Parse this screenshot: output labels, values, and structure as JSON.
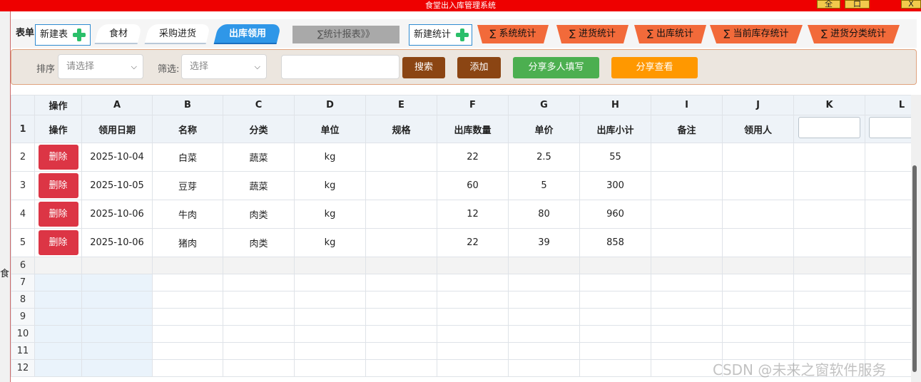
{
  "window": {
    "title": "食堂出入库管理系统",
    "buttons": {
      "fullscreen": "全",
      "restore": "口",
      "close": "X"
    }
  },
  "left_edge": {
    "stub_a": "食"
  },
  "tabs": {
    "form_label": "表单",
    "new_table": "新建表",
    "items": [
      "食材",
      "采购进货",
      "出库领用"
    ],
    "active": "出库领用",
    "report": "∑统计报表》》",
    "new_stat": "新建统计",
    "stats": [
      "∑ 系统统计",
      "∑ 进货统计",
      "∑ 出库统计",
      "∑ 当前库存统计",
      "∑ 进货分类统计"
    ]
  },
  "filter": {
    "sort_label": "排序",
    "sort_placeholder": "请选择",
    "filter_label": "筛选:",
    "filter_placeholder": "选择",
    "search_value": "",
    "search_btn": "搜索",
    "add_btn": "添加",
    "share_fill_btn": "分享多人填写",
    "share_view_btn": "分享查看"
  },
  "colors": {
    "titlebar": "#ee0000",
    "active_tab": "#2f97e8",
    "stat_tab": "#f26a3a",
    "search_btn": "#8b4513",
    "add_btn": "#8b4513",
    "share_fill_btn": "#4caf50",
    "share_view_btn": "#ff9800",
    "delete_btn": "#dc3545"
  },
  "grid": {
    "col_letters": [
      "操作",
      "A",
      "B",
      "C",
      "D",
      "E",
      "F",
      "G",
      "H",
      "I",
      "J",
      "K",
      "L"
    ],
    "field_headers": [
      "操作",
      "领用日期",
      "名称",
      "分类",
      "单位",
      "规格",
      "出库数量",
      "单价",
      "出库小计",
      "备注",
      "领用人"
    ],
    "delete_label": "删除",
    "header_row_num": "1",
    "rows": [
      {
        "num": "2",
        "date": "2025-10-04",
        "name": "白菜",
        "category": "蔬菜",
        "unit": "kg",
        "spec": "",
        "qty": "22",
        "price": "2.5",
        "subtotal": "55",
        "note": "",
        "receiver": ""
      },
      {
        "num": "3",
        "date": "2025-10-05",
        "name": "豆芽",
        "category": "蔬菜",
        "unit": "kg",
        "spec": "",
        "qty": "60",
        "price": "5",
        "subtotal": "300",
        "note": "",
        "receiver": ""
      },
      {
        "num": "4",
        "date": "2025-10-06",
        "name": "牛肉",
        "category": "肉类",
        "unit": "kg",
        "spec": "",
        "qty": "12",
        "price": "80",
        "subtotal": "960",
        "note": "",
        "receiver": ""
      },
      {
        "num": "5",
        "date": "2025-10-06",
        "name": "猪肉",
        "category": "肉类",
        "unit": "kg",
        "spec": "",
        "qty": "22",
        "price": "39",
        "subtotal": "858",
        "note": "",
        "receiver": ""
      }
    ],
    "empty_rows": [
      "6",
      "7",
      "8",
      "9",
      "10",
      "11",
      "12"
    ]
  },
  "watermark": "CSDN @未来之窗软件服务"
}
